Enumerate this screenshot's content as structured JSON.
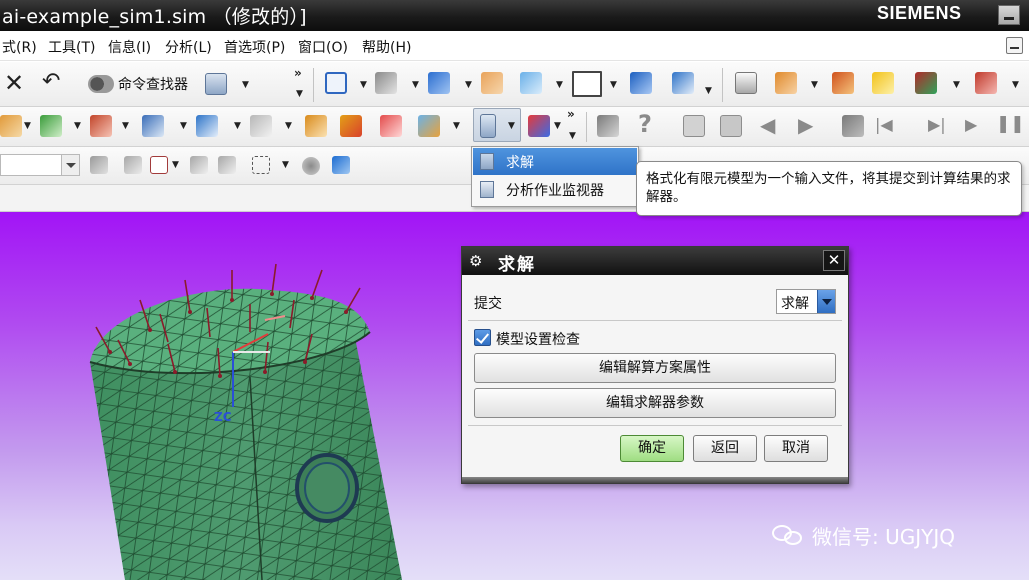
{
  "window": {
    "title": "ai-example_sim1.sim （修改的）]",
    "brand": "SIEMENS"
  },
  "menu": {
    "items": [
      "式(R)",
      "工具(T)",
      "信息(I)",
      "分析(L)",
      "首选项(P)",
      "窗口(O)",
      "帮助(H)"
    ]
  },
  "toolbar": {
    "command_finder_label": "命令查找器",
    "overflow_glyph": "»"
  },
  "dropdown_menu": {
    "items": [
      {
        "label": "求解",
        "icon": "solve-icon",
        "selected": true
      },
      {
        "label": "分析作业监视器",
        "icon": "job-monitor-icon",
        "selected": false
      }
    ]
  },
  "tooltip": {
    "text": "格式化有限元模型为一个输入文件，将其提交到计算结果的求解器。"
  },
  "dialog": {
    "title": "求解",
    "submit_label": "提交",
    "submit_value": "求解",
    "model_check_label": "模型设置检查",
    "model_check_checked": true,
    "edit_solution_button": "编辑解算方案属性",
    "edit_solver_button": "编辑求解器参数",
    "ok_button": "确定",
    "back_button": "返回",
    "cancel_button": "取消"
  },
  "viewport": {
    "axis_label": "ZC",
    "background_top": "#a214f6",
    "background_bottom": "#e4dff8",
    "mesh_color": "#4f9b70"
  },
  "watermark": {
    "text": "微信号: UGJYJQ"
  },
  "colors": {
    "selection": "#3b82d6",
    "ok_button": "#9fdd82"
  }
}
